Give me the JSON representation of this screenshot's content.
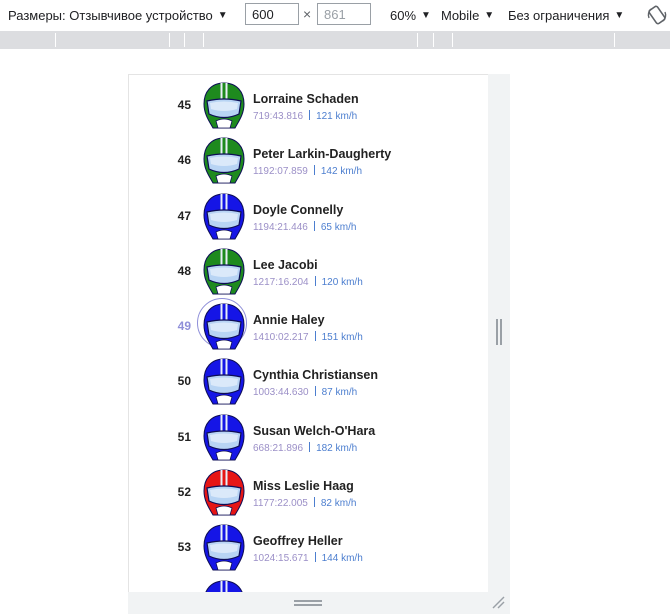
{
  "toolbar": {
    "dimensions_label": "Размеры: Отзывчивое устройство",
    "width_value": "600",
    "height_placeholder": "861",
    "times": "×",
    "zoom": "60%",
    "device_type": "Mobile",
    "throttle": "Без ограничения"
  },
  "riders": [
    {
      "rank": "45",
      "name": "Lorraine Schaden",
      "time": "719:43.816",
      "speed": "121 km/h",
      "color": "#1e8a1e"
    },
    {
      "rank": "46",
      "name": "Peter Larkin-Daugherty",
      "time": "1192:07.859",
      "speed": "142 km/h",
      "color": "#1e8a1e"
    },
    {
      "rank": "47",
      "name": "Doyle Connelly",
      "time": "1194:21.446",
      "speed": "65 km/h",
      "color": "#1515e6"
    },
    {
      "rank": "48",
      "name": "Lee Jacobi",
      "time": "1217:16.204",
      "speed": "120 km/h",
      "color": "#1e8a1e"
    },
    {
      "rank": "49",
      "name": "Annie Haley",
      "time": "1410:02.217",
      "speed": "151 km/h",
      "color": "#1515e6",
      "active": true
    },
    {
      "rank": "50",
      "name": "Cynthia Christiansen",
      "time": "1003:44.630",
      "speed": "87 km/h",
      "color": "#1515e6"
    },
    {
      "rank": "51",
      "name": "Susan Welch-O'Hara",
      "time": "668:21.896",
      "speed": "182 km/h",
      "color": "#1515e6"
    },
    {
      "rank": "52",
      "name": "Miss Leslie Haag",
      "time": "1177:22.005",
      "speed": "82 km/h",
      "color": "#e61515"
    },
    {
      "rank": "53",
      "name": "Geoffrey Heller",
      "time": "1024:15.671",
      "speed": "144 km/h",
      "color": "#1515e6"
    },
    {
      "rank": "",
      "name": "",
      "time": "",
      "speed": "",
      "color": "#1515e6"
    }
  ]
}
